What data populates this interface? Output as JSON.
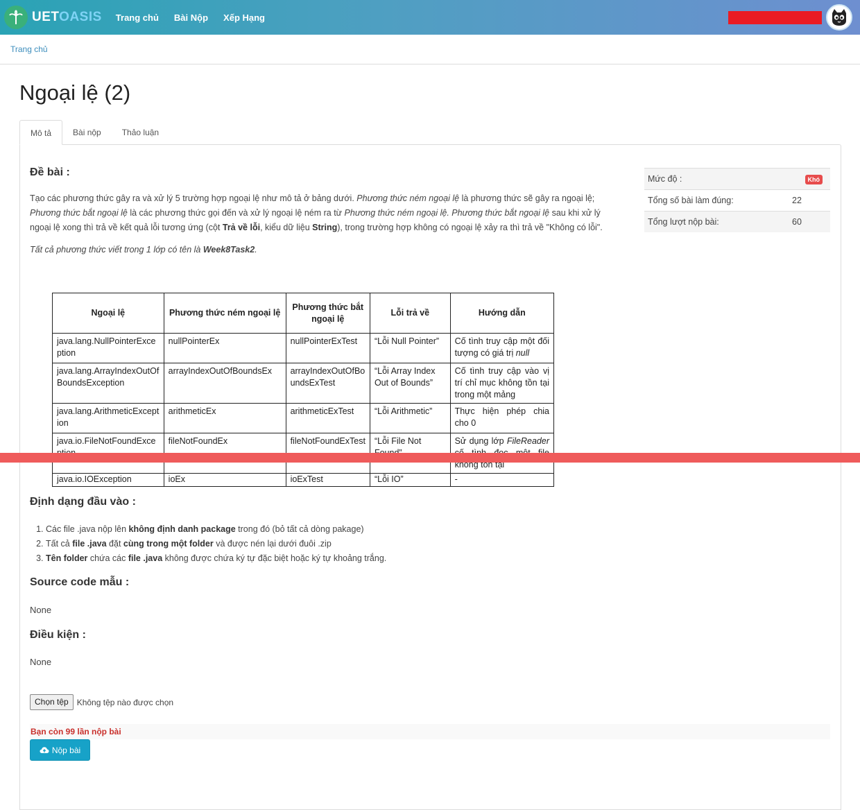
{
  "nav": {
    "brand_uet": "UET",
    "brand_oasis": "OASIS",
    "links": [
      "Trang chủ",
      "Bài Nộp",
      "Xếp Hạng"
    ],
    "red_bar_color": "#ea1b23",
    "avatar_icon": "cat-avatar-icon"
  },
  "breadcrumb": {
    "home": "Trang chủ"
  },
  "page_title": "Ngoại lệ (2)",
  "tabs": [
    "Mô tả",
    "Bài nộp",
    "Thảo luận"
  ],
  "problem": {
    "heading": "Đề bài :",
    "p1_a": "Tạo các phương thức gây ra và xử lý 5 trường hợp ngoại lệ như mô tả ở bảng dưới. ",
    "p1_b": "Phương thức ném ngoại lệ",
    "p1_c": " là phương thức sẽ gây ra ngoại lệ; ",
    "p1_d": "Phương thức bắt ngoại lệ",
    "p1_e": " là các phương thức gọi đến và xử lý ngoại lệ ném ra từ ",
    "p1_f": "Phương thức ném ngoại lệ. Phương thức bắt ngoại lệ",
    "p1_g": " sau khi xử lý ngoại lệ xong thì trả về kết quả lỗi tương ứng (cột ",
    "p1_h": "Trả về lỗi",
    "p1_i": ", kiểu dữ liệu ",
    "p1_j": "String",
    "p1_k": "), trong trường hợp không có ngoại lệ xảy ra thì trả về \"Không có lỗi\".",
    "p2_a": "Tất cả phương thức viết trong 1 lớp có tên là ",
    "p2_b": "Week8Task2",
    "p2_c": "."
  },
  "table": {
    "headers": [
      "Ngoại lệ",
      "Phương thức ném ngoại lệ",
      "Phương thức bắt ngoại lệ",
      "Lỗi trả về",
      "Hướng dẫn"
    ],
    "rows": [
      [
        "java.lang.NullPointerException",
        "nullPointerEx",
        "nullPointerExTest",
        "“Lỗi Null Pointer”",
        "Cố tình truy cập một đối tượng có giá trị null"
      ],
      [
        "java.lang.ArrayIndexOutOfBoundsException",
        "arrayIndexOutOfBoundsEx",
        "arrayIndexOutOfBoundsExTest",
        "“Lỗi Array Index Out of Bounds”",
        "Cố tình truy cập vào vị trí chỉ mục không tồn tại trong một mảng"
      ],
      [
        "java.lang.ArithmeticException",
        "arithmeticEx",
        "arithmeticExTest",
        "“Lỗi Arithmetic”",
        "Thực hiện phép chia cho 0"
      ],
      [
        "java.io.FileNotFoundException",
        "fileNotFoundEx",
        "fileNotFoundExTest",
        "“Lỗi File Not Found”",
        "Sử dụng lớp FileReader cố tình đọc một file không tồn tại"
      ],
      [
        "java.io.IOException",
        "ioEx",
        "ioExTest",
        "“Lỗi IO”",
        "-"
      ]
    ]
  },
  "input_format": {
    "heading": "Định dạng đầu vào :",
    "items": [
      {
        "a": "Các file .java nộp lên ",
        "b": "không định danh package",
        "c": " trong đó (bỏ tất cả dòng pakage)"
      },
      {
        "a": "Tất cả ",
        "b": "file .java",
        "c": " đặt ",
        "d": "cùng trong một folder",
        "e": " và được nén lại dưới đuôi .zip"
      },
      {
        "a": "Tên folder",
        "b": " chứa các ",
        "c": "file .java",
        "d": " không được chứa ký tự đặc biệt hoặc ký tự khoảng trắng."
      }
    ]
  },
  "source": {
    "heading": "Source code mẫu :",
    "value": "None"
  },
  "condition": {
    "heading": "Điều kiện :",
    "value": "None"
  },
  "upload": {
    "button": "Chọn tệp",
    "status": "Không tệp nào được chọn"
  },
  "remaining": "Bạn còn 99 lần nộp bài",
  "submit": "Nộp bài",
  "stats": {
    "level_label": "Mức độ :",
    "level_value": "Khó",
    "correct_label": "Tổng số bài làm đúng:",
    "correct_value": "22",
    "submissions_label": "Tổng lượt nộp bài:",
    "submissions_value": "60"
  }
}
